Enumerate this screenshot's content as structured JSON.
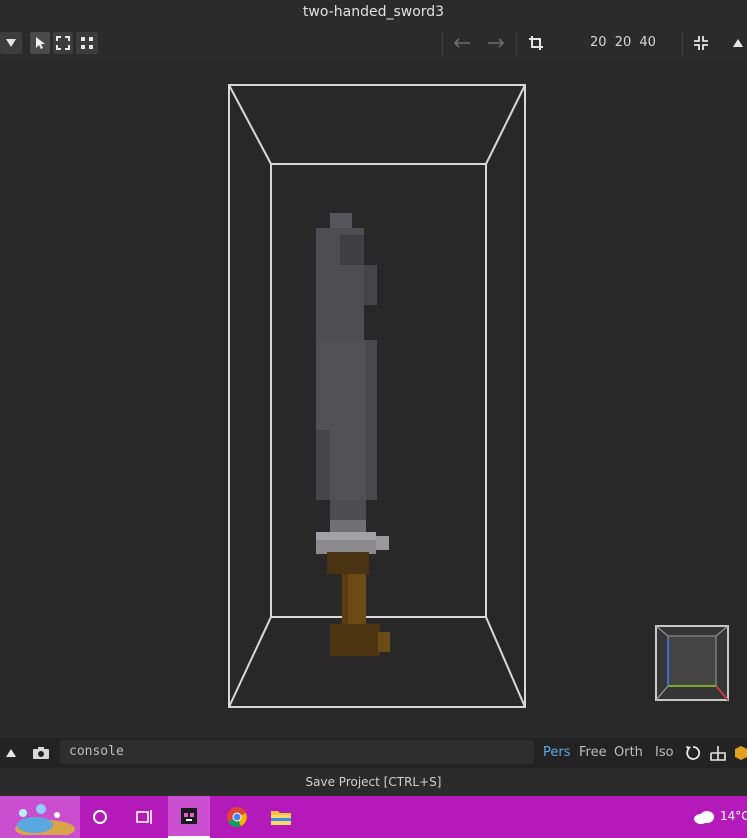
{
  "window": {
    "title": "two-handed_sword3"
  },
  "toolbar": {
    "menu_icon": "triangle-down-icon",
    "select_tool_icon": "cursor-arrow-icon",
    "select_area_icon": "selection-frame-icon",
    "select_all_icon": "select-corners-icon",
    "undo_icon": "arrow-left-icon",
    "redo_icon": "arrow-right-icon",
    "crop_icon": "crop-icon",
    "dimensions": {
      "x": "20",
      "y": "20",
      "z": "40"
    },
    "shrink_icon": "shrink-arrows-icon",
    "collapse_icon": "triangle-up-icon"
  },
  "bottom": {
    "console_label": "console",
    "camera_modes": [
      "Pers",
      "Free",
      "Orth",
      "Iso"
    ],
    "active_camera": "Pers",
    "accent_color": "#5fa8e6"
  },
  "status": {
    "hint": "Save Project [CTRL+S]"
  },
  "taskbar": {
    "background": "#b41ab9",
    "weather_temp": "14°C"
  }
}
